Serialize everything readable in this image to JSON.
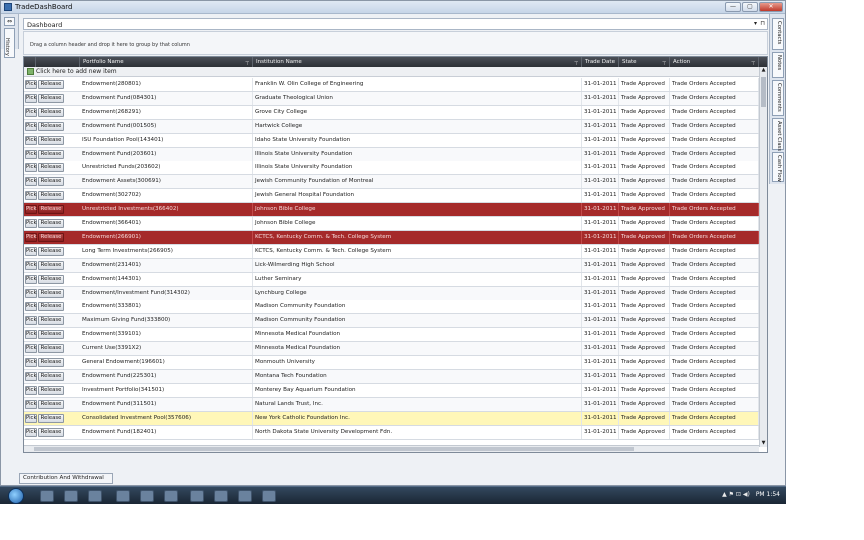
{
  "window": {
    "title": "TradeDashBoard",
    "buttons": [
      "—",
      "▢",
      "✕"
    ]
  },
  "left_strip": {
    "pin": "⇔",
    "tab": "History"
  },
  "dashboard_select": {
    "value": "Dashboard",
    "arrow": "▾",
    "pin": "⊓"
  },
  "group_hint": "Drag a column header and drop it here to group by that column",
  "columns": [
    {
      "label": "",
      "filter": false
    },
    {
      "label": "",
      "filter": false
    },
    {
      "label": "Portfolio Name",
      "filter": true
    },
    {
      "label": "Institution Name",
      "filter": true
    },
    {
      "label": "Trade Date",
      "filter": false
    },
    {
      "label": "State",
      "filter": true
    },
    {
      "label": "Action",
      "filter": true
    }
  ],
  "filter_glyph": "⊤",
  "add_row": "Click here to add new item",
  "buttons": {
    "pick": "Pick",
    "release": "Release"
  },
  "rows": [
    {
      "portfolio": "Endowment(280801)",
      "institution": "Franklin W. Olin College of Engineering",
      "date": "31-01-2011",
      "state": "Trade Approved",
      "action": "Trade Orders Accepted",
      "style": ""
    },
    {
      "portfolio": "Endowment Fund(084301)",
      "institution": "Graduate Theological Union",
      "date": "31-01-2011",
      "state": "Trade Approved",
      "action": "Trade Orders Accepted",
      "style": "alt"
    },
    {
      "portfolio": "Endowment(268291)",
      "institution": "Grove City College",
      "date": "31-01-2011",
      "state": "Trade Approved",
      "action": "Trade Orders Accepted",
      "style": ""
    },
    {
      "portfolio": "Endowment Fund(001505)",
      "institution": "Hartwick College",
      "date": "31-01-2011",
      "state": "Trade Approved",
      "action": "Trade Orders Accepted",
      "style": "alt"
    },
    {
      "portfolio": "ISU Foundation Pool(143401)",
      "institution": "Idaho State University Foundation",
      "date": "31-01-2011",
      "state": "Trade Approved",
      "action": "Trade Orders Accepted",
      "style": ""
    },
    {
      "portfolio": "Endowment Fund(203601)",
      "institution": "Illinois State University Foundation",
      "date": "31-01-2011",
      "state": "Trade Approved",
      "action": "Trade Orders Accepted",
      "style": "alt"
    },
    {
      "portfolio": "Unrestricted Funds(203602)",
      "institution": "Illinois State University Foundation",
      "date": "31-01-2011",
      "state": "Trade Approved",
      "action": "Trade Orders Accepted",
      "style": ""
    },
    {
      "portfolio": "Endowment Assets(300691)",
      "institution": "Jewish Community Foundation of Montreal",
      "date": "31-01-2011",
      "state": "Trade Approved",
      "action": "Trade Orders Accepted",
      "style": "alt"
    },
    {
      "portfolio": "Endowment(302702)",
      "institution": "Jewish General Hospital Foundation",
      "date": "31-01-2011",
      "state": "Trade Approved",
      "action": "Trade Orders Accepted",
      "style": ""
    },
    {
      "portfolio": "Unrestricted Investments(366402)",
      "institution": "Johnson Bible College",
      "date": "31-01-2011",
      "state": "Trade Approved",
      "action": "Trade Orders Accepted",
      "style": "red"
    },
    {
      "portfolio": "Endowment(366401)",
      "institution": "Johnson Bible College",
      "date": "31-01-2011",
      "state": "Trade Approved",
      "action": "Trade Orders Accepted",
      "style": ""
    },
    {
      "portfolio": "Endowment(266901)",
      "institution": "KCTCS, Kentucky Comm. & Tech. College System",
      "date": "31-01-2011",
      "state": "Trade Approved",
      "action": "Trade Orders Accepted",
      "style": "red"
    },
    {
      "portfolio": "Long Term Investments(266905)",
      "institution": "KCTCS, Kentucky Comm. & Tech. College System",
      "date": "31-01-2011",
      "state": "Trade Approved",
      "action": "Trade Orders Accepted",
      "style": ""
    },
    {
      "portfolio": "Endowment(231401)",
      "institution": "Lick-Wilmerding High School",
      "date": "31-01-2011",
      "state": "Trade Approved",
      "action": "Trade Orders Accepted",
      "style": "alt"
    },
    {
      "portfolio": "Endowment(144301)",
      "institution": "Luther Seminary",
      "date": "31-01-2011",
      "state": "Trade Approved",
      "action": "Trade Orders Accepted",
      "style": ""
    },
    {
      "portfolio": "Endowment/Investment Fund(314302)",
      "institution": "Lynchburg College",
      "date": "31-01-2011",
      "state": "Trade Approved",
      "action": "Trade Orders Accepted",
      "style": "alt"
    },
    {
      "portfolio": "Endowment(333801)",
      "institution": "Madison Community Foundation",
      "date": "31-01-2011",
      "state": "Trade Approved",
      "action": "Trade Orders Accepted",
      "style": ""
    },
    {
      "portfolio": "Maximum Giving Fund(333800)",
      "institution": "Madison Community Foundation",
      "date": "31-01-2011",
      "state": "Trade Approved",
      "action": "Trade Orders Accepted",
      "style": "alt"
    },
    {
      "portfolio": "Endowment(339101)",
      "institution": "Minnesota Medical Foundation",
      "date": "31-01-2011",
      "state": "Trade Approved",
      "action": "Trade Orders Accepted",
      "style": ""
    },
    {
      "portfolio": "Current Use(3391X2)",
      "institution": "Minnesota Medical Foundation",
      "date": "31-01-2011",
      "state": "Trade Approved",
      "action": "Trade Orders Accepted",
      "style": "alt"
    },
    {
      "portfolio": "General Endowment(196601)",
      "institution": "Monmouth University",
      "date": "31-01-2011",
      "state": "Trade Approved",
      "action": "Trade Orders Accepted",
      "style": ""
    },
    {
      "portfolio": "Endowment Fund(225301)",
      "institution": "Montana Tech Foundation",
      "date": "31-01-2011",
      "state": "Trade Approved",
      "action": "Trade Orders Accepted",
      "style": "alt"
    },
    {
      "portfolio": "Investment Portfolio(341501)",
      "institution": "Monterey Bay Aquarium Foundation",
      "date": "31-01-2011",
      "state": "Trade Approved",
      "action": "Trade Orders Accepted",
      "style": ""
    },
    {
      "portfolio": "Endowment Fund(311501)",
      "institution": "Natural Lands Trust, Inc.",
      "date": "31-01-2011",
      "state": "Trade Approved",
      "action": "Trade Orders Accepted",
      "style": "alt"
    },
    {
      "portfolio": "Consolidated Investment Pool(357606)",
      "institution": "New York Catholic Foundation Inc.",
      "date": "31-01-2011",
      "state": "Trade Approved",
      "action": "Trade Orders Accepted",
      "style": "yellow"
    },
    {
      "portfolio": "Endowment Fund(182401)",
      "institution": "North Dakota State University Development Fdn.",
      "date": "31-01-2011",
      "state": "Trade Approved",
      "action": "Trade Orders Accepted",
      "style": ""
    }
  ],
  "right_tabs": [
    "Contacts",
    "Notes",
    "Comments",
    "Asset Class",
    "Cash Flow"
  ],
  "bottom_tab": "Contribution And Withdrawal",
  "taskbar": {
    "clock": "PM 1:54",
    "tray": "▲ ⚑ ⊡ ◀)"
  },
  "colors": {
    "selected_row": "#a52a2a",
    "highlight_row": "#fff7b8",
    "header": "#2c3036"
  }
}
